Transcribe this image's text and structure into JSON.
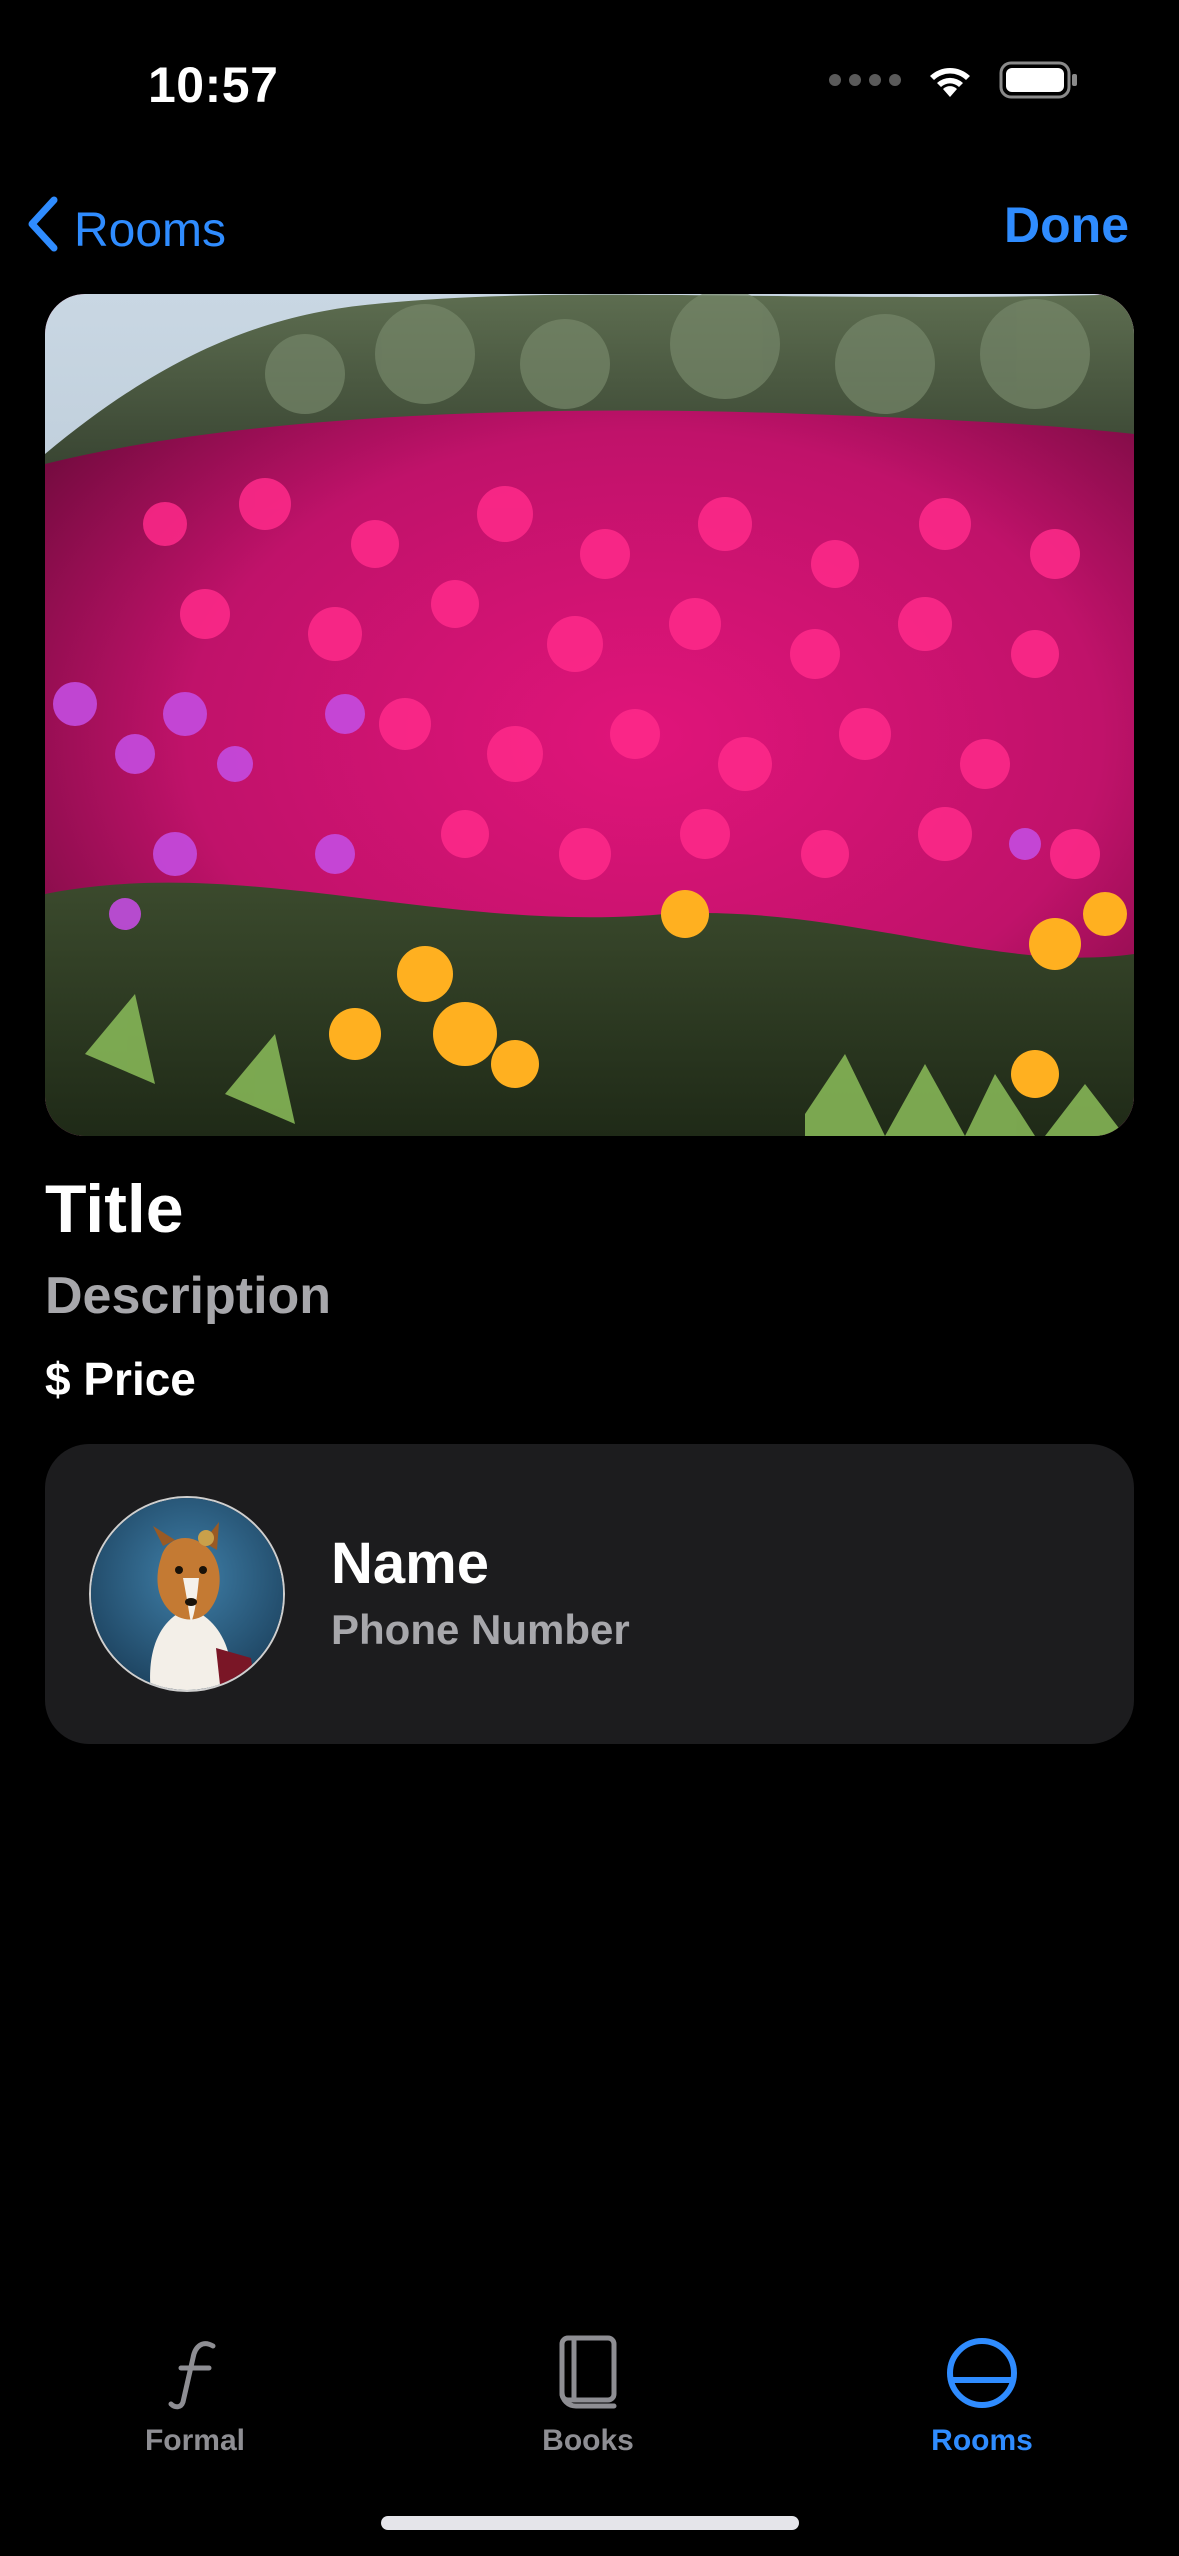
{
  "status_bar": {
    "time": "10:57",
    "icons": [
      "signal-dots-icon",
      "wifi-icon",
      "battery-icon"
    ]
  },
  "nav": {
    "back_label": "Rooms",
    "back_icon": "chevron-left-icon",
    "done_label": "Done"
  },
  "hero": {
    "image": "flower-field-photo"
  },
  "detail": {
    "title": "Title",
    "description": "Description",
    "price": "$ Price"
  },
  "contact": {
    "avatar": "collie-portrait-photo",
    "name": "Name",
    "phone": "Phone Number"
  },
  "tab_bar": {
    "tabs": [
      {
        "label": "Formal",
        "icon": "function-f-icon",
        "selected": false
      },
      {
        "label": "Books",
        "icon": "book-icon",
        "selected": false
      },
      {
        "label": "Rooms",
        "icon": "circle-room-icon",
        "selected": true
      }
    ]
  },
  "colors": {
    "accent": "#2f8cff",
    "background": "#000000",
    "card": "#1c1c1e",
    "secondary_text": "#a7a7ab",
    "tab_inactive": "#8e8e93"
  }
}
